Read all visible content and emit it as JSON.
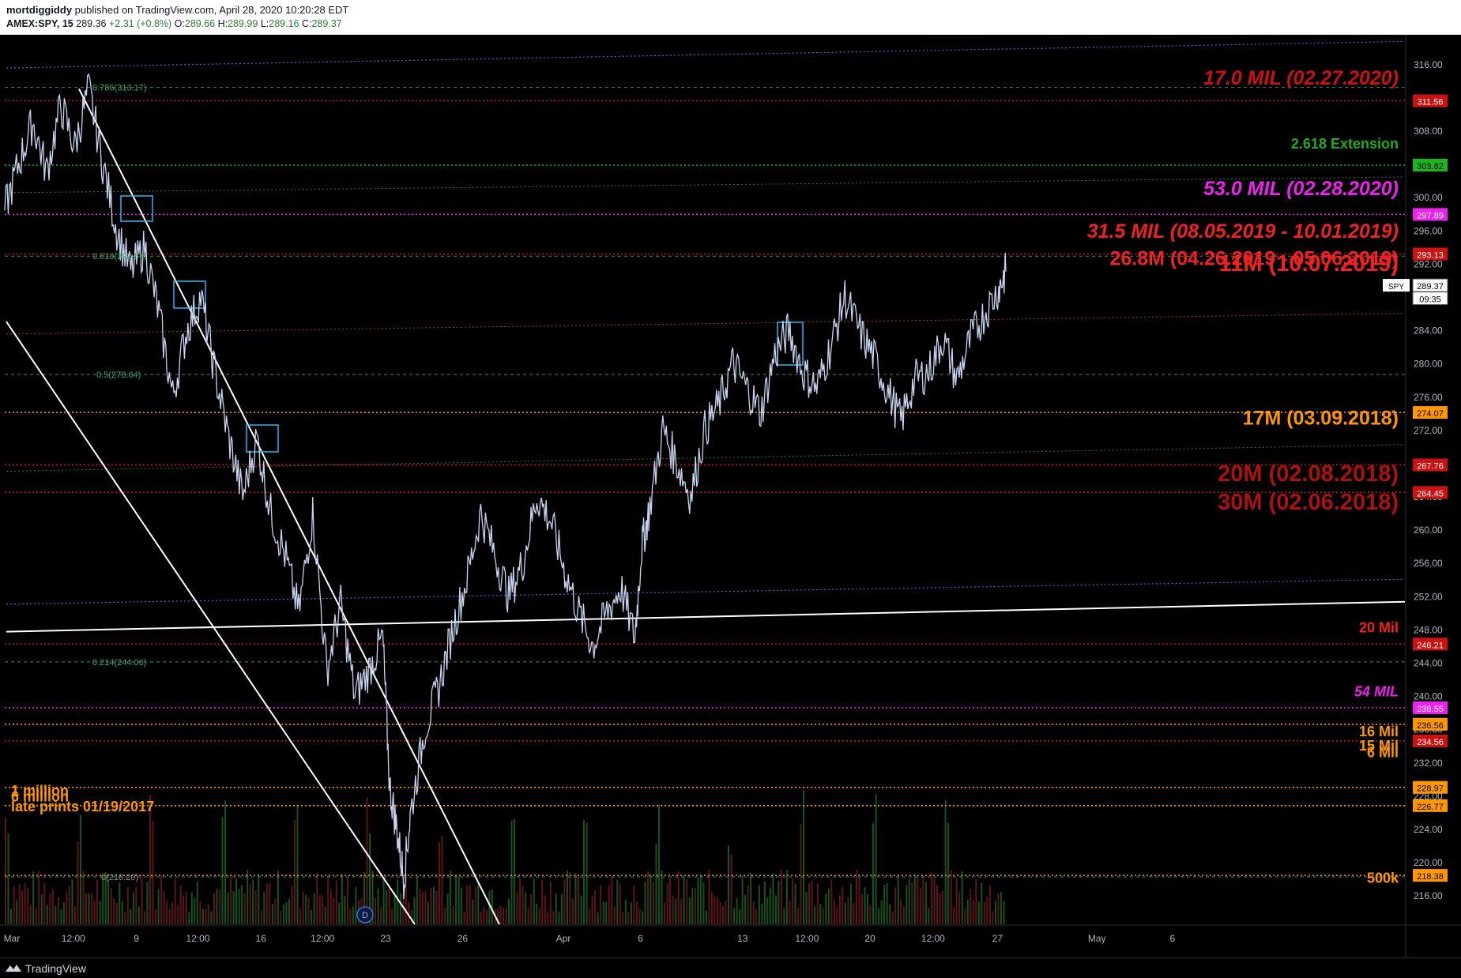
{
  "header": {
    "author": "mortdiggiddy",
    "published_text": "published on TradingView.com, April 28, 2020 10:20:28 EDT",
    "symbol": "AMEX:SPY, 15",
    "last": "289.36",
    "change": "+2.31 (+0.8%)",
    "o_label": "O:",
    "o": "289.66",
    "h_label": "H:",
    "h": "289.99",
    "l_label": "L:",
    "l": "289.16",
    "c_label": "C:",
    "c": "289.37"
  },
  "footer": {
    "brand": "TradingView"
  },
  "chart_data": {
    "type": "line",
    "title": "AMEX:SPY, 15",
    "ylim": [
      212.5,
      319.5
    ],
    "y_ticks": [
      216,
      220,
      224,
      228,
      232,
      236,
      240,
      244,
      248,
      252,
      256,
      260,
      264,
      268,
      272,
      276,
      280,
      284,
      288,
      292,
      296,
      300,
      304,
      308,
      312,
      316
    ],
    "x_ticks": [
      {
        "label": "Mar",
        "pos": 0.005
      },
      {
        "label": "12:00",
        "pos": 0.049
      },
      {
        "label": "9",
        "pos": 0.094
      },
      {
        "label": "12:00",
        "pos": 0.138
      },
      {
        "label": "16",
        "pos": 0.183
      },
      {
        "label": "12:00",
        "pos": 0.227
      },
      {
        "label": "23",
        "pos": 0.272
      },
      {
        "label": "26",
        "pos": 0.327
      },
      {
        "label": "Apr",
        "pos": 0.399
      },
      {
        "label": "6",
        "pos": 0.454
      },
      {
        "label": "13",
        "pos": 0.527
      },
      {
        "label": "12:00",
        "pos": 0.573
      },
      {
        "label": "20",
        "pos": 0.618
      },
      {
        "label": "12:00",
        "pos": 0.663
      },
      {
        "label": "27",
        "pos": 0.709
      },
      {
        "label": "May",
        "pos": 0.78
      },
      {
        "label": "6",
        "pos": 0.834
      }
    ],
    "series": [
      {
        "values": [
          [
            0.0,
            298.5
          ],
          [
            0.01,
            304
          ],
          [
            0.02,
            309
          ],
          [
            0.03,
            303
          ],
          [
            0.04,
            311
          ],
          [
            0.05,
            306
          ],
          [
            0.06,
            313
          ],
          [
            0.07,
            304
          ],
          [
            0.08,
            296
          ],
          [
            0.09,
            291
          ],
          [
            0.1,
            294
          ],
          [
            0.11,
            286
          ],
          [
            0.12,
            276
          ],
          [
            0.13,
            284
          ],
          [
            0.14,
            288
          ],
          [
            0.15,
            279
          ],
          [
            0.16,
            271
          ],
          [
            0.17,
            264
          ],
          [
            0.18,
            271
          ],
          [
            0.19,
            262
          ],
          [
            0.2,
            257
          ],
          [
            0.21,
            250
          ],
          [
            0.22,
            262
          ],
          [
            0.23,
            243
          ],
          [
            0.24,
            251
          ],
          [
            0.25,
            240
          ],
          [
            0.26,
            243
          ],
          [
            0.27,
            247
          ],
          [
            0.275,
            229
          ],
          [
            0.28,
            224
          ],
          [
            0.285,
            218
          ],
          [
            0.29,
            226
          ],
          [
            0.3,
            236
          ],
          [
            0.31,
            241
          ],
          [
            0.32,
            248
          ],
          [
            0.33,
            254
          ],
          [
            0.34,
            262
          ],
          [
            0.35,
            257
          ],
          [
            0.36,
            252
          ],
          [
            0.37,
            256
          ],
          [
            0.38,
            264
          ],
          [
            0.39,
            261
          ],
          [
            0.4,
            255
          ],
          [
            0.41,
            250
          ],
          [
            0.42,
            246
          ],
          [
            0.43,
            250
          ],
          [
            0.44,
            253
          ],
          [
            0.45,
            247
          ],
          [
            0.455,
            258
          ],
          [
            0.46,
            262
          ],
          [
            0.47,
            272
          ],
          [
            0.48,
            268
          ],
          [
            0.49,
            264
          ],
          [
            0.5,
            272
          ],
          [
            0.51,
            275
          ],
          [
            0.52,
            280
          ],
          [
            0.53,
            277
          ],
          [
            0.54,
            274
          ],
          [
            0.55,
            281
          ],
          [
            0.56,
            284
          ],
          [
            0.57,
            279
          ],
          [
            0.58,
            277
          ],
          [
            0.59,
            282
          ],
          [
            0.6,
            288
          ],
          [
            0.61,
            284
          ],
          [
            0.62,
            281
          ],
          [
            0.63,
            277
          ],
          [
            0.64,
            273
          ],
          [
            0.65,
            278
          ],
          [
            0.66,
            279
          ],
          [
            0.67,
            283
          ],
          [
            0.68,
            278
          ],
          [
            0.69,
            283
          ],
          [
            0.7,
            286
          ],
          [
            0.71,
            289
          ],
          [
            0.715,
            291
          ]
        ]
      }
    ],
    "annotations": [
      {
        "text": "17.0 MIL (02.27.2020)",
        "y": 313.5,
        "color": "#cc1111"
      },
      {
        "text": "2.618 Extension",
        "y": 305.8,
        "color": "#22aa22"
      },
      {
        "text": "53.0 MIL (02.28.2020)",
        "y": 300.2,
        "color": "#ee22ee"
      },
      {
        "text": "31.5 MIL (08.05.2019 - 10.01.2019)",
        "y": 295.1,
        "color": "#ee2222"
      },
      {
        "text": "26.8M (04.26.2019 - 05.06.2019)",
        "y": 291.8,
        "color": "#ee2222"
      },
      {
        "text": "11M (10.07.2019)",
        "y": 291.1,
        "color": "#ee2222"
      },
      {
        "text": "17M (03.09.2018)",
        "y": 272.6,
        "color": "#ff9800"
      },
      {
        "text": "20M (02.08.2018)",
        "y": 265.8,
        "color": "#aa1111"
      },
      {
        "text": "30M (02.06.2018)",
        "y": 262.4,
        "color": "#aa1111"
      },
      {
        "text": "20 Mil",
        "y": 247.6,
        "color": "#ee2222"
      },
      {
        "text": "54 MIL",
        "y": 239.9,
        "color": "#ee22ee"
      },
      {
        "text": "16 Mil",
        "y": 235.1,
        "color": "#ff9800"
      },
      {
        "text": "15 Mil",
        "y": 233.4,
        "color": "#ff9800"
      },
      {
        "text": "6 Mil",
        "y": 232.6,
        "color": "#ff9800"
      },
      {
        "text": "1 million",
        "y": 228.0,
        "color": "#ff9800"
      },
      {
        "text": "6 million",
        "y": 227.3,
        "color": "#ff9800"
      },
      {
        "text": "late prints 01/19/2017",
        "y": 226.1,
        "color": "#ff9800"
      },
      {
        "text": "500k",
        "y": 217.5,
        "color": "#ff9800"
      }
    ],
    "fib_labels": [
      {
        "text": "0.786(313.17)",
        "y": 313.17
      },
      {
        "text": "0.618(292.87)",
        "y": 292.87
      },
      {
        "text": "0.5(278.64)",
        "y": 278.64
      },
      {
        "text": "0.214(244.06)",
        "y": 244.06
      },
      {
        "text": "0(218.20)",
        "y": 218.2
      }
    ],
    "price_labels": [
      {
        "text": "311.56",
        "y": 311.56,
        "color": "#cc1111"
      },
      {
        "text": "303.82",
        "y": 303.82,
        "color": "#1db51d"
      },
      {
        "text": "297.89",
        "y": 297.89,
        "color": "#ee22ee"
      },
      {
        "text": "293.13",
        "y": 293.13,
        "color": "#cc1111"
      },
      {
        "text": "289.37",
        "y": 289.37,
        "color": "#ffffff"
      },
      {
        "text": "09:35",
        "y": 287.8,
        "color": "#ffffff"
      },
      {
        "text": "274.07",
        "y": 274.07,
        "color": "#ff9800"
      },
      {
        "text": "267.76",
        "y": 267.76,
        "color": "#cc1111"
      },
      {
        "text": "264.45",
        "y": 264.45,
        "color": "#cc1111"
      },
      {
        "text": "246.21",
        "y": 246.21,
        "color": "#cc1111"
      },
      {
        "text": "238.55",
        "y": 238.55,
        "color": "#ee22ee"
      },
      {
        "text": "236.56",
        "y": 236.56,
        "color": "#ff9800"
      },
      {
        "text": "234.56",
        "y": 234.56,
        "color": "#cc1111"
      },
      {
        "text": "228.97",
        "y": 228.97,
        "color": "#ff9800"
      },
      {
        "text": "226.77",
        "y": 226.77,
        "color": "#ff9800"
      },
      {
        "text": "218.38",
        "y": 218.38,
        "color": "#ff9800"
      }
    ],
    "spy_tag": "SPY",
    "colors": {
      "price": "#c8d4f0",
      "axis": "#b2b5be",
      "red": "#cc1111",
      "magenta": "#ee22ee",
      "orange": "#ff9800",
      "green": "#22aa22",
      "blue": "#3a6bd8"
    }
  }
}
